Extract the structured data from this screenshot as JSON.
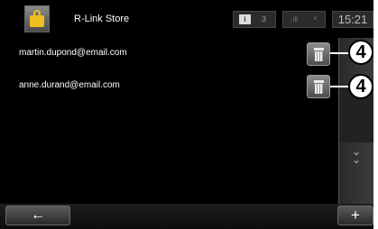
{
  "header": {
    "title": "R-Link Store",
    "store_icon": "shopping-bag-icon",
    "message_count": "3",
    "signal_mark": "×",
    "clock": "15:21"
  },
  "accounts": [
    {
      "email": "martin.dupond@email.com",
      "callout": "4"
    },
    {
      "email": "anne.durand@email.com",
      "callout": "4"
    }
  ],
  "scroll": {
    "up": "^",
    "down": "⌄"
  },
  "footer": {
    "back_label": "←",
    "add_label": "+"
  },
  "colors": {
    "background": "#000000",
    "text": "#ffffff",
    "store_bag": "#f0c020",
    "button": "#5a5a5a"
  }
}
